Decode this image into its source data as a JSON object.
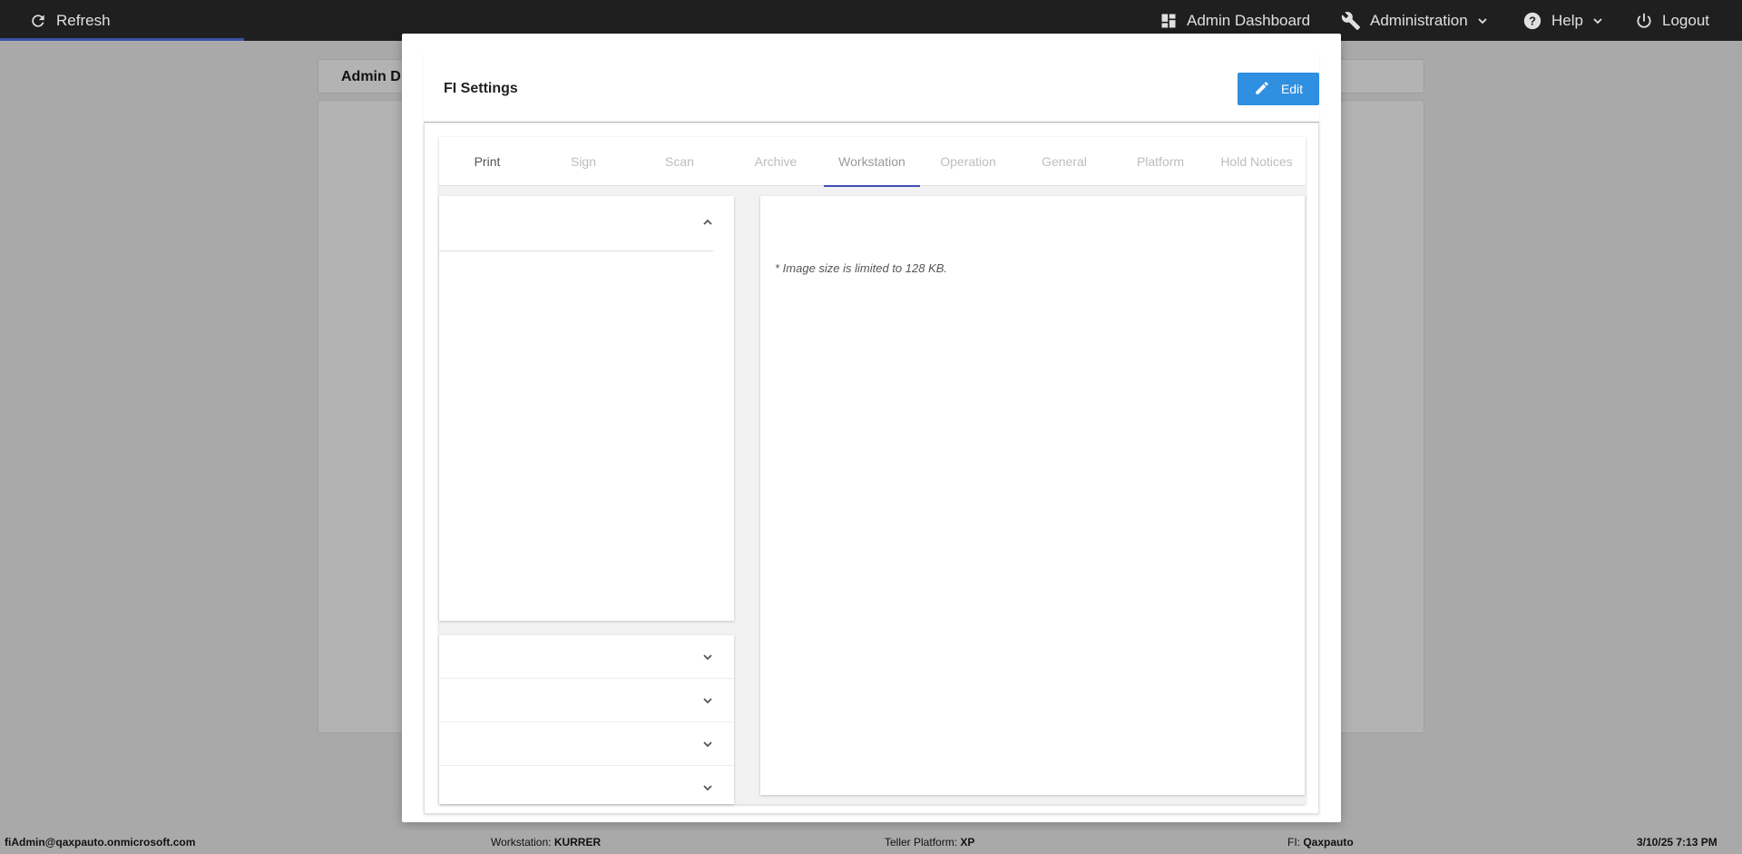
{
  "topbar": {
    "refresh": "Refresh",
    "admin_dashboard": "Admin Dashboard",
    "administration": "Administration",
    "help": "Help",
    "logout": "Logout",
    "progress_fraction": 0.14
  },
  "background": {
    "header_title": "Admin D"
  },
  "modal": {
    "title": "FI Settings",
    "edit_label": "Edit",
    "tabs": [
      {
        "label": "Print"
      },
      {
        "label": "Sign"
      },
      {
        "label": "Scan"
      },
      {
        "label": "Archive"
      },
      {
        "label": "Workstation"
      },
      {
        "label": "Operation"
      },
      {
        "label": "General"
      },
      {
        "label": "Platform"
      },
      {
        "label": "Hold Notices"
      }
    ],
    "active_tab": "Workstation",
    "image_note": "* Image size is limited to 128 KB."
  },
  "statusbar": {
    "user": "fiAdmin@qaxpauto.onmicrosoft.com",
    "workstation_label": "Workstation:",
    "workstation_value": "KURRER",
    "platform_label": "Teller Platform:",
    "platform_value": "XP",
    "fi_label": "FI:",
    "fi_value": "Qaxpauto",
    "datetime": "3/10/25 7:13 PM"
  },
  "colors": {
    "navbar": "#1f1f1f",
    "accent": "#3f51b5",
    "edit_button": "#2f8fe0",
    "overlay": "#a9a9a9"
  }
}
